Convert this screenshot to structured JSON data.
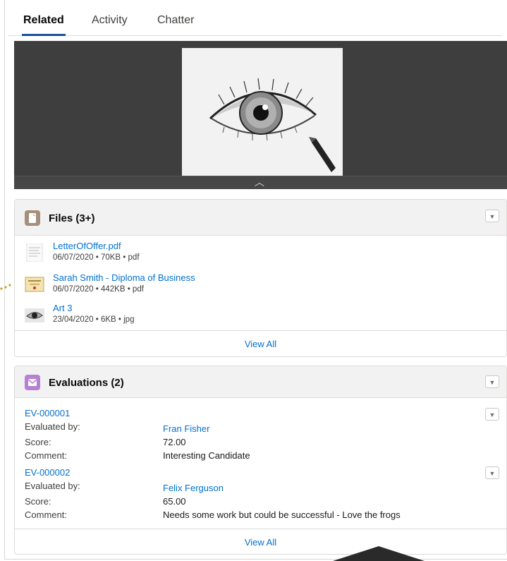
{
  "tabs": [
    {
      "label": "Related",
      "active": true
    },
    {
      "label": "Activity",
      "active": false
    },
    {
      "label": "Chatter",
      "active": false
    }
  ],
  "files_card": {
    "title": "Files (3+)",
    "items": [
      {
        "name": "LetterOfOffer.pdf",
        "meta": "06/07/2020 • 70KB • pdf",
        "thumb": "document-thumbnail"
      },
      {
        "name": "Sarah Smith - Diploma of Business",
        "meta": "06/07/2020 • 442KB • pdf",
        "thumb": "certificate-thumbnail"
      },
      {
        "name": "Art 3",
        "meta": "23/04/2020 • 6KB • jpg",
        "thumb": "eye-drawing-thumbnail"
      }
    ],
    "view_all": "View All"
  },
  "evaluations_card": {
    "title": "Evaluations (2)",
    "items": [
      {
        "id": "EV-000001",
        "evaluated_by_label": "Evaluated by:",
        "evaluated_by": "Fran Fisher",
        "score_label": "Score:",
        "score": "72.00",
        "comment_label": "Comment:",
        "comment": "Interesting Candidate"
      },
      {
        "id": "EV-000002",
        "evaluated_by_label": "Evaluated by:",
        "evaluated_by": "Felix Ferguson",
        "score_label": "Score:",
        "score": "65.00",
        "comment_label": "Comment:",
        "comment": "Needs some work but could be successful - Love the frogs"
      }
    ],
    "view_all": "View All"
  },
  "colors": {
    "link": "#0070d2",
    "files_icon": "#a48f7a",
    "evaluations_icon": "#b781d3",
    "active_tab_underline": "#1b5297",
    "preview_bg": "#3e3e3e"
  },
  "icons": {
    "files_icon": "file-icon",
    "evaluations_icon": "envelope-icon",
    "menu": "chevron-down-icon",
    "preview_toggle": "chevron-up-icon"
  }
}
